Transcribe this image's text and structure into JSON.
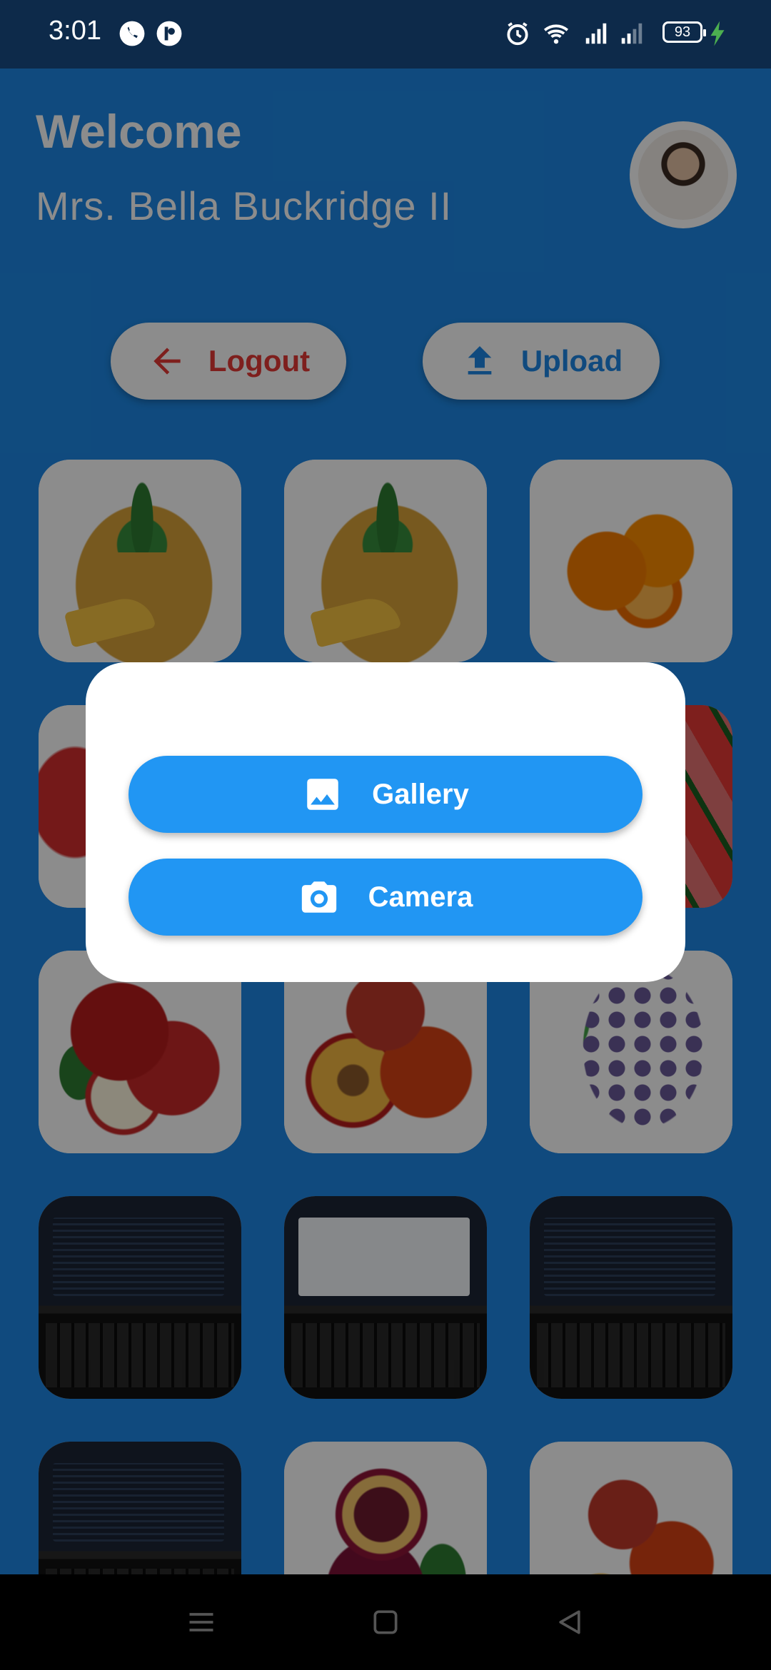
{
  "status_bar": {
    "time": "3:01",
    "battery": "93",
    "icons": [
      "phone-call-icon",
      "notification-app-icon",
      "alarm-icon",
      "wifi-icon",
      "signal-icon",
      "signal-2-icon",
      "charging-icon"
    ]
  },
  "header": {
    "welcome": "Welcome",
    "username": "Mrs. Bella Buckridge II"
  },
  "actions": {
    "logout_label": "Logout",
    "upload_label": "Upload"
  },
  "gallery": {
    "tiles": [
      "pineapple",
      "pineapple",
      "orange",
      "strawberry",
      "watermelon",
      "apple",
      "peach",
      "grapes",
      "laptop",
      "laptop",
      "laptop",
      "laptop",
      "plum",
      "peach"
    ]
  },
  "dialog": {
    "gallery_label": "Gallery",
    "camera_label": "Camera"
  },
  "colors": {
    "primary": "#2196f3",
    "logout": "#e53935",
    "background": "#1e88e5"
  },
  "nav_bar": {
    "icons": [
      "menu-icon",
      "home-icon",
      "back-icon"
    ]
  }
}
